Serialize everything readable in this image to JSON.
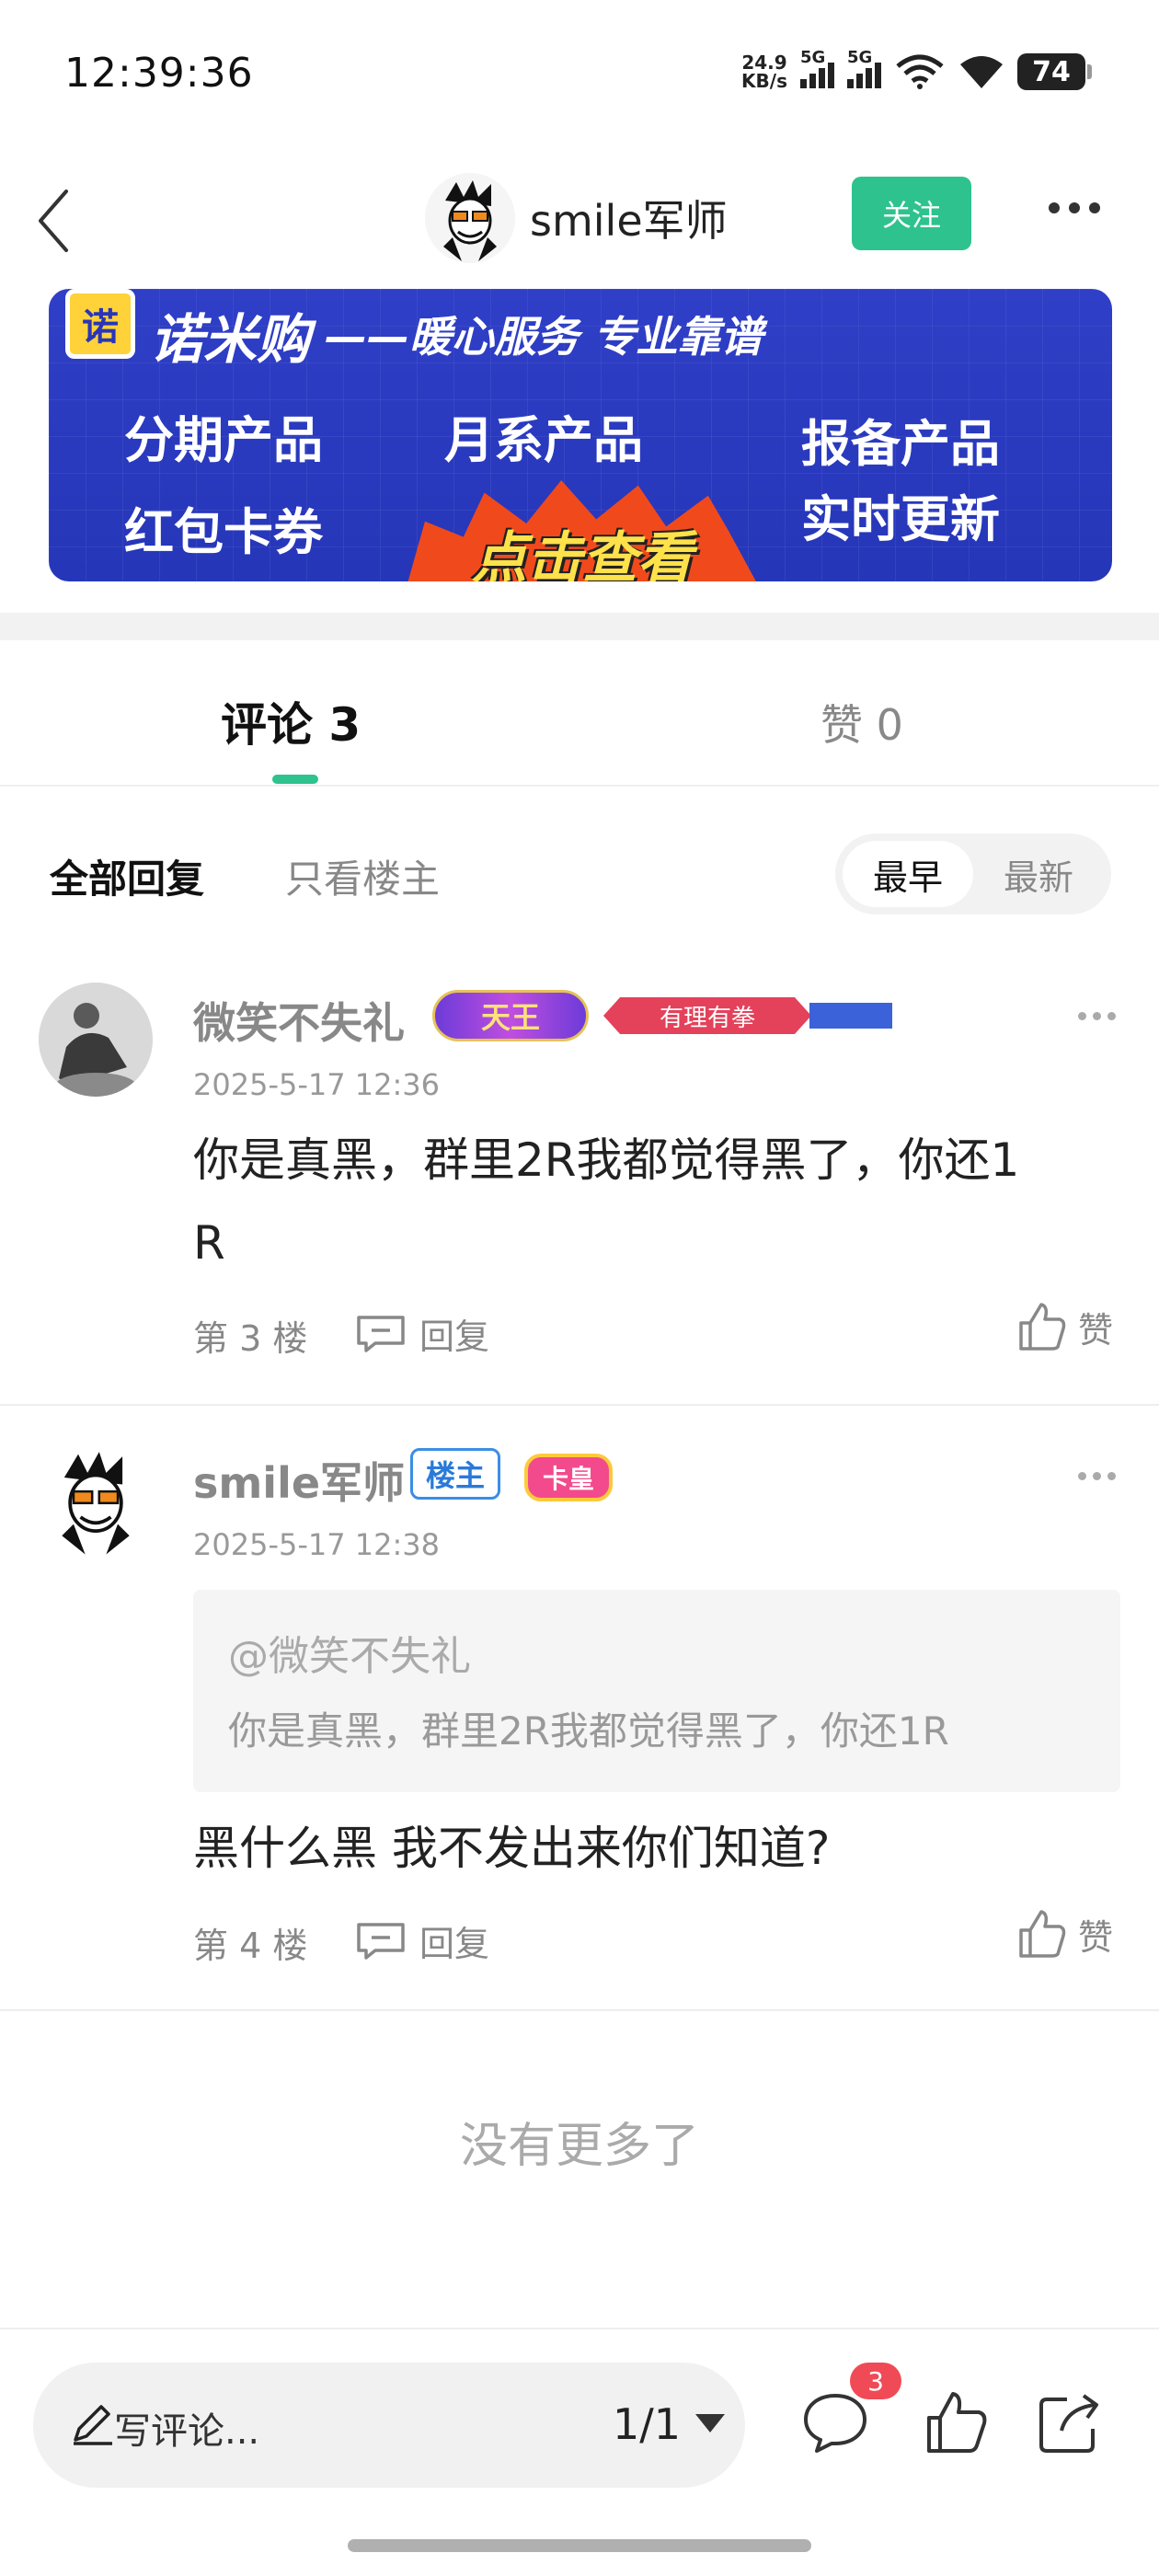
{
  "status_bar": {
    "time": "12:39:36",
    "net_speed_value": "24.9",
    "net_speed_unit": "KB/s",
    "sim1_label": "5G",
    "sim2_label": "5G",
    "battery": "74"
  },
  "header": {
    "author_name": "smile军师",
    "follow_label": "关注"
  },
  "banner": {
    "logo_char": "诺",
    "brand": "诺米购",
    "slogan": "——暖心服务 专业靠谱",
    "items": [
      "分期产品",
      "月系产品",
      "报备产品",
      "红包卡券",
      "实时更新"
    ],
    "cta": "点击查看"
  },
  "tabs": {
    "comments_label": "评论 3",
    "likes_label": "赞 0"
  },
  "filters": {
    "all_replies": "全部回复",
    "op_only": "只看楼主",
    "sort_earliest": "最早",
    "sort_newest": "最新"
  },
  "comments": [
    {
      "user": "微笑不失礼",
      "badge_king": "天王",
      "badge_ribbon": "有理有拳",
      "date": "2025-5-17 12:36",
      "text_line1": "你是真黑，群里2R我都觉得黑了，你还1",
      "text_line2": "R",
      "floor": "第 3 楼",
      "reply_label": "回复",
      "like_label": "赞"
    },
    {
      "user": "smile军师",
      "badge_op": "楼主",
      "badge_card": "卡皇",
      "date": "2025-5-17 12:38",
      "quote_user": "@微笑不失礼",
      "quote_text": "你是真黑，群里2R我都觉得黑了，你还1R",
      "text": "黑什么黑 我不发出来你们知道?",
      "floor": "第 4 楼",
      "reply_label": "回复",
      "like_label": "赞"
    }
  ],
  "no_more": "没有更多了",
  "bottom_bar": {
    "comment_placeholder": "写评论...",
    "page_indicator": "1/1",
    "comment_count_badge": "3"
  },
  "colors": {
    "accent_green": "#2ec28f",
    "banner_blue": "#2a3ac0",
    "badge_red": "#f04a56"
  }
}
